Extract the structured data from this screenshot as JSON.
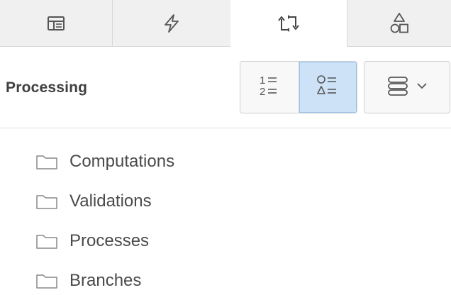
{
  "tabs": [
    {
      "icon": "layout-panel-icon",
      "active": false
    },
    {
      "icon": "lightning-icon",
      "active": false
    },
    {
      "icon": "process-arrows-icon",
      "active": true
    },
    {
      "icon": "shapes-icon",
      "active": false
    }
  ],
  "header": {
    "title": "Processing"
  },
  "view_toggle": {
    "options": [
      {
        "icon": "ordered-list-icon",
        "selected": false,
        "glyph_top": "1 =",
        "glyph_bottom": "2 ="
      },
      {
        "icon": "shapes-list-icon",
        "selected": true,
        "glyph_top": "○ =",
        "glyph_bottom": "△ ="
      }
    ]
  },
  "menu_button": {
    "icon": "stack-icon",
    "caret": "chevron-down-icon"
  },
  "tree": {
    "items": [
      {
        "label": "Computations",
        "icon": "folder-icon"
      },
      {
        "label": "Validations",
        "icon": "folder-icon"
      },
      {
        "label": "Processes",
        "icon": "folder-icon"
      },
      {
        "label": "Branches",
        "icon": "folder-icon"
      }
    ]
  },
  "colors": {
    "tab_bg": "#f0f0f0",
    "active_tab_bg": "#ffffff",
    "selected_toggle_bg": "#cde1f7",
    "text": "#404040",
    "icon": "#555555"
  }
}
